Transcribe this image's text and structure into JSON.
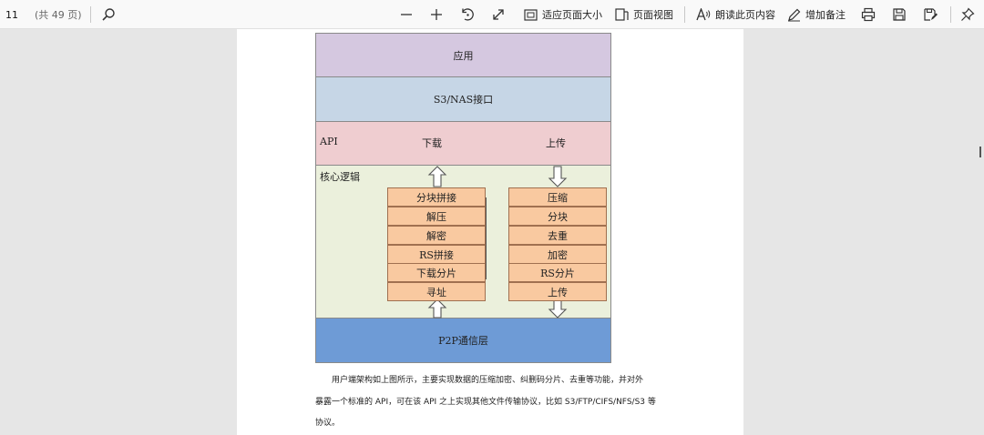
{
  "toolbar": {
    "page_number": "11",
    "page_total": "(共 49 页)",
    "fit_page_label": "适应页面大小",
    "page_view_label": "页面视图",
    "read_aloud_label": "朗读此页内容",
    "add_note_label": "增加备注"
  },
  "diagram": {
    "app_layer": "应用",
    "s3_layer": "S3/NAS接口",
    "api_label": "API",
    "download_label": "下载",
    "upload_label": "上传",
    "core_label": "核心逻辑",
    "download_steps": [
      "分块拼接",
      "解压",
      "解密",
      "RS拼接",
      "下载分片",
      "寻址"
    ],
    "upload_steps": [
      "压缩",
      "分块",
      "去重",
      "加密",
      "RS分片",
      "上传"
    ],
    "p2p_layer": "P2P通信层"
  },
  "paragraph": {
    "line1": "用户端架构如上图所示，主要实现数据的压缩加密、纠删码分片、去重等功能，并对外",
    "line2": "暴露一个标准的 API，可在该 API 之上实现其他文件传输协议，比如 S3/FTP/CIFS/NFS/S3 等",
    "line3": "协议。"
  },
  "colors": {
    "app_layer": "#d5c8e0",
    "s3_layer": "#c6d6e6",
    "api_layer": "#efcdd0",
    "core_layer": "#ebf0dc",
    "p2p_layer": "#6e9bd6",
    "step_box": "#f9c9a0"
  }
}
